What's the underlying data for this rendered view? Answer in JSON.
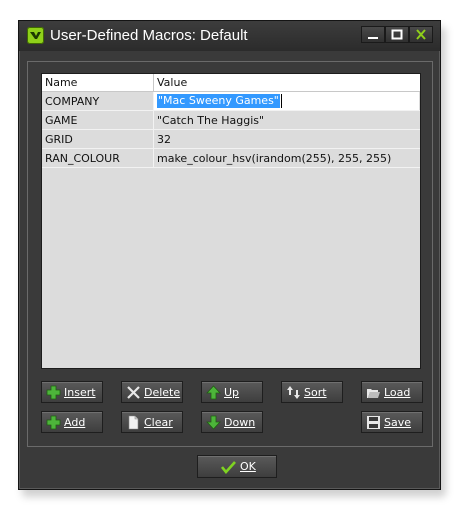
{
  "window": {
    "title": "User-Defined Macros: Default",
    "buttons": [
      "minimize",
      "maximize",
      "close"
    ]
  },
  "table": {
    "columns": [
      "Name",
      "Value"
    ],
    "rows": [
      {
        "name": "COMPANY",
        "value": "\"Mac Sweeny Games\"",
        "editing": true
      },
      {
        "name": "GAME",
        "value": "\"Catch The Haggis\""
      },
      {
        "name": "GRID",
        "value": "32"
      },
      {
        "name": "RAN_COLOUR",
        "value": "make_colour_hsv(irandom(255), 255, 255)"
      }
    ]
  },
  "actions": {
    "insert": {
      "label": "Insert",
      "icon": "plus-icon"
    },
    "delete": {
      "label": "Delete",
      "icon": "cross-icon"
    },
    "up": {
      "label": "Up",
      "icon": "arrow-up-icon"
    },
    "sort": {
      "label": "Sort",
      "icon": "sort-icon"
    },
    "load": {
      "label": "Load",
      "icon": "folder-open-icon"
    },
    "add": {
      "label": "Add",
      "icon": "plus-icon"
    },
    "clear": {
      "label": "Clear",
      "icon": "blank-page-icon"
    },
    "down": {
      "label": "Down",
      "icon": "arrow-down-icon"
    },
    "save": {
      "label": "Save",
      "icon": "floppy-disk-icon"
    }
  },
  "ok": {
    "label": "OK",
    "icon": "checkmark-icon"
  },
  "colors": {
    "accent": "#8fd01a",
    "selection": "#3399ff",
    "panel": "#3a3a3a"
  }
}
